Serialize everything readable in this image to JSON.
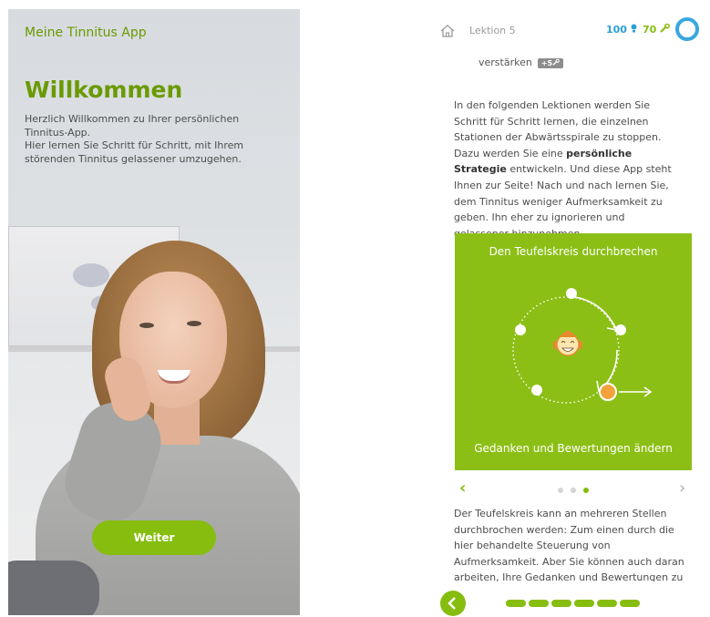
{
  "left_screen": {
    "app_title": "Meine Tinnitus App",
    "welcome_title": "Willkommen",
    "intro_line1": "Herzlich Willkommen zu Ihrer persönlichen Tinnitus-App.",
    "intro_line2": "Hier lernen Sie Schritt für Schritt, mit Ihrem störenden Tinnitus gelassener umzugehen.",
    "continue_label": "Weiter"
  },
  "right_screen": {
    "header": {
      "lesson_label": "Lektion 5",
      "points_value": "100",
      "points_icon": "bulb-icon",
      "tools_value": "70",
      "tools_icon": "wrench-icon"
    },
    "prev_line": {
      "text": "verstärken",
      "badge": "+5"
    },
    "paragraph1": {
      "part1": "In den folgenden Lektionen werden Sie Schritt für Schritt lernen, die einzelnen Stationen der Abwärtsspirale zu stoppen. Dazu werden Sie eine ",
      "bold": "persönliche Strategie",
      "part2": " entwickeln. Und diese App steht Ihnen zur Seite! Nach und nach lernen Sie, dem Tinnitus weniger Aufmerksamkeit zu geben. Ihn eher zu ignorieren und gelassener hinzunehmen."
    },
    "card": {
      "title": "Den Teufelskreis durchbrechen",
      "subtitle": "Gedanken und Bewertungen ändern"
    },
    "carousel": {
      "current_page": 3,
      "total_pages": 3
    },
    "paragraph2": "Der Teufelskreis kann an mehreren Stellen durchbrochen werden: Zum einen durch die hier behandelte Steuerung von Aufmerksamkeit. Aber Sie können auch daran arbeiten, Ihre Gedanken und Bewertungen zu steuern. So",
    "progress": {
      "completed_segments": 6,
      "total_segments": 6
    }
  },
  "colors": {
    "brand_green": "#86bd0f",
    "title_green": "#6a9a00",
    "points_blue": "#2a9fd8",
    "highlight_orange": "#f3a23b"
  }
}
